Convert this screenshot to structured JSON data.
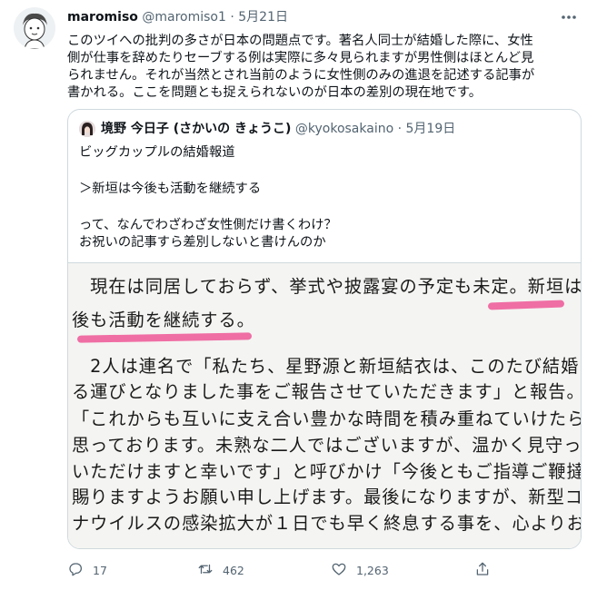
{
  "tweet": {
    "author_name": "maromiso",
    "author_handle": "@maromiso1",
    "dot": "·",
    "date": "5月21日",
    "text_lines": [
      "このツイへの批判の多さが日本の問題点です。著名人同士が結婚した際に、女性",
      "側が仕事を辞めたりセーブする例は実際に多々見られますが男性側はほとんど見",
      "られません。それが当然とされ当前のように女性側のみの進退を記述する記事が",
      "書かれる。ここを問題とも捉えられないのが日本の差別の現在地です。"
    ]
  },
  "quote": {
    "author_name": "境野 今日子 (さかいの きょうこ)",
    "author_handle": "@kyokosakaino",
    "dot": "·",
    "date": "5月19日",
    "text": {
      "line1": "ビッグカップルの結婚報道",
      "line2": "＞新垣は今後も活動を継続する",
      "line3": "って、なんでわざわざ女性側だけ書くわけ？",
      "line4": "お祝いの記事すら差別しないと書けんのか"
    },
    "article_lines": [
      "　現在は同居しておらず、挙式や披露宴の予定も未定。新垣は今",
      "後も活動を継続する。",
      "　2人は連名で「私たち、星野源と新垣結衣は、このたび結婚す",
      "る運びとなりました事をご報告させていただきます」と報告。",
      "「これからも互いに支え合い豊かな時間を積み重ねていけたらと",
      "思っております。未熟な二人ではございますが、温かく見守って",
      "いただけますと幸いです」と呼びかけ「今後ともご指導ご鞭撻を",
      "賜りますようお願い申し上げます。最後になりますが、新型コロ",
      "ナウイルスの感染拡大が１日でも早く終息する事を、心よりお祈"
    ],
    "highlight_color": "#ef6ea4"
  },
  "actions": {
    "reply_count": "17",
    "retweet_count": "462",
    "like_count": "1,263",
    "icon_color": "#536471"
  }
}
